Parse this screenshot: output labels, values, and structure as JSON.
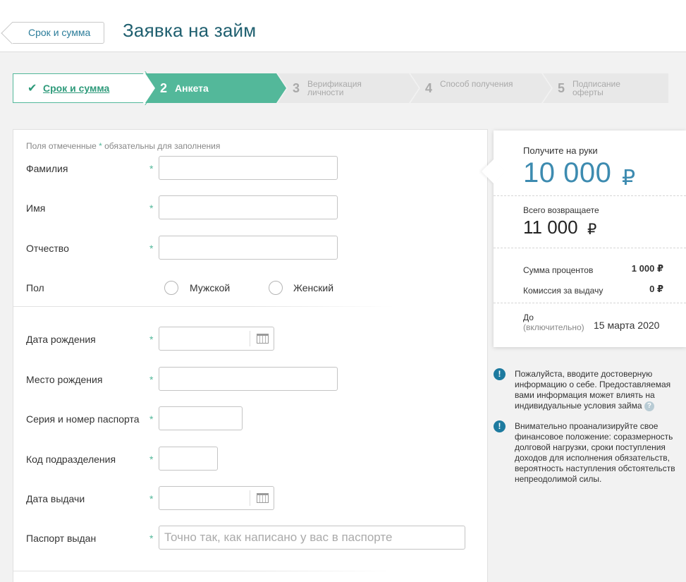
{
  "header": {
    "back_label": "Срок и сумма",
    "title": "Заявка на займ"
  },
  "stepper": {
    "steps": [
      {
        "number": "",
        "label": "Срок и сумма",
        "state": "done"
      },
      {
        "number": "2",
        "label": "Анкета",
        "state": "active"
      },
      {
        "number": "3",
        "label": "Верификация личности",
        "state": "pending"
      },
      {
        "number": "4",
        "label": "Способ получения",
        "state": "pending"
      },
      {
        "number": "5",
        "label": "Подписание оферты",
        "state": "pending"
      }
    ]
  },
  "form": {
    "hint_prefix": "Поля отмеченные ",
    "hint_star": "*",
    "hint_suffix": " обязательны для заполнения",
    "required_mark": "*",
    "fields": {
      "last_name": {
        "label": "Фамилия",
        "value": ""
      },
      "first_name": {
        "label": "Имя",
        "value": ""
      },
      "patronymic": {
        "label": "Отчество",
        "value": ""
      },
      "gender": {
        "label": "Пол",
        "options": [
          "Мужской",
          "Женский"
        ],
        "selected": ""
      },
      "birth_date": {
        "label": "Дата рождения",
        "value": ""
      },
      "birth_place": {
        "label": "Место рождения",
        "value": ""
      },
      "passport_number": {
        "label": "Серия и номер паспорта",
        "value": ""
      },
      "division_code": {
        "label": "Код подразделения",
        "value": ""
      },
      "issue_date": {
        "label": "Дата выдачи",
        "value": ""
      },
      "issued_by": {
        "label": "Паспорт выдан",
        "value": "",
        "placeholder": "Точно так, как написано у вас в паспорте"
      }
    }
  },
  "summary": {
    "receive_label": "Получите на руки",
    "receive_amount": "10 000",
    "currency": "₽",
    "return_label": "Всего возвращаете",
    "return_amount": "11 000",
    "interest_label": "Сумма процентов",
    "interest_value": "1 000 ₽",
    "fee_label": "Комиссия за выдачу",
    "fee_value": "0 ₽",
    "due_label": "До",
    "due_sub": "(включительно)",
    "due_date": "15 марта 2020"
  },
  "notices": [
    {
      "icon": "info-icon",
      "text": "Пожалуйста, вводите достоверную информацию о себе. Предоставляемая вами информация может влиять на индивидуальные условия займа",
      "has_help": true
    },
    {
      "icon": "info-icon",
      "text": "Внимательно проанализируйте свое финансовое положение: соразмерность долговой нагрузки, сроки поступления доходов для исполнения обязательств, вероятность наступления обстоятельств непреодолимой силы.",
      "has_help": false
    }
  ],
  "colors": {
    "accent_green": "#53b89a",
    "accent_blue": "#3d8bb0",
    "title": "#1f5f6f"
  }
}
